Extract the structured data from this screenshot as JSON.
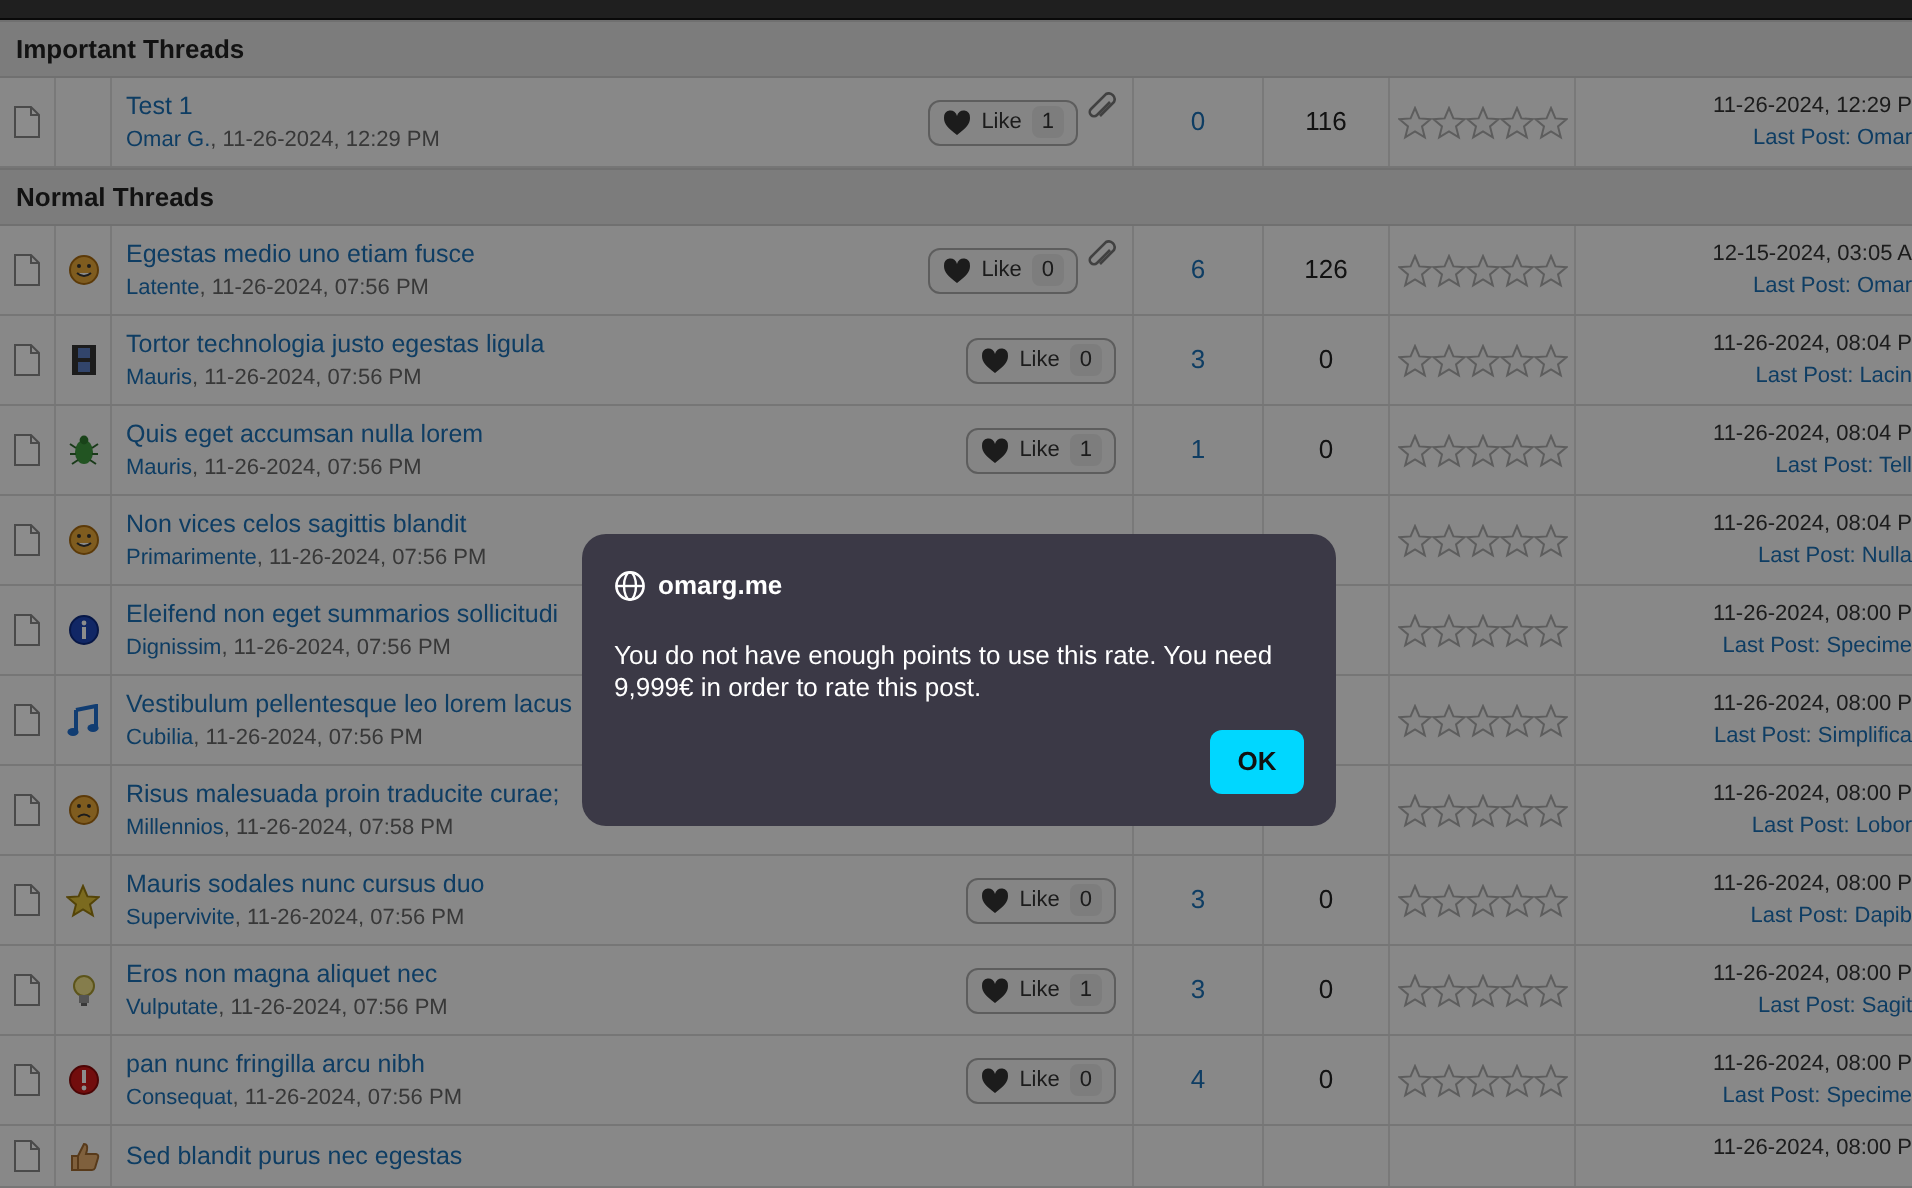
{
  "sections": [
    {
      "title": "Important Threads",
      "rows": [
        {
          "title": "Test 1",
          "author": "Omar G.",
          "date": ", 11-26-2024, 12:29 PM",
          "kind": "none",
          "like": {
            "label": "Like",
            "count": "1"
          },
          "attachment": true,
          "replies": "0",
          "views": "116",
          "stars": 0,
          "last_date": "11-26-2024, 12:29 P",
          "last_post": "Last Post: Omar"
        }
      ]
    },
    {
      "title": "Normal Threads",
      "rows": [
        {
          "title": "Egestas medio uno etiam fusce",
          "author": "Latente",
          "date": ", 11-26-2024, 07:56 PM",
          "kind": "smile",
          "like": {
            "label": "Like",
            "count": "0"
          },
          "attachment": true,
          "replies": "6",
          "views": "126",
          "stars": 0,
          "last_date": "12-15-2024, 03:05 A",
          "last_post": "Last Post: Omar"
        },
        {
          "title": "Tortor technologia justo egestas ligula",
          "author": "Mauris",
          "date": ", 11-26-2024, 07:56 PM",
          "kind": "film",
          "like": {
            "label": "Like",
            "count": "0"
          },
          "attachment": false,
          "replies": "3",
          "views": "0",
          "stars": 0,
          "last_date": "11-26-2024, 08:04 P",
          "last_post": "Last Post: Lacin"
        },
        {
          "title": "Quis eget accumsan nulla lorem",
          "author": "Mauris",
          "date": ", 11-26-2024, 07:56 PM",
          "kind": "bug",
          "like": {
            "label": "Like",
            "count": "1"
          },
          "attachment": false,
          "replies": "1",
          "views": "0",
          "stars": 0,
          "last_date": "11-26-2024, 08:04 P",
          "last_post": "Last Post: Tell"
        },
        {
          "title": "Non vices celos sagittis blandit",
          "author": "Primarimente",
          "date": ", 11-26-2024, 07:56 PM",
          "kind": "smile",
          "attachment": false,
          "stars": 0,
          "last_date": "11-26-2024, 08:04 P",
          "last_post": "Last Post: Nulla"
        },
        {
          "title": "Eleifend non eget summarios sollicitudi",
          "author": "Dignissim",
          "date": ", 11-26-2024, 07:56 PM",
          "kind": "info",
          "attachment": false,
          "stars": 0,
          "last_date": "11-26-2024, 08:00 P",
          "last_post": "Last Post: Specime"
        },
        {
          "title": "Vestibulum pellentesque leo lorem lacus",
          "author": "Cubilia",
          "date": ", 11-26-2024, 07:56 PM",
          "kind": "music",
          "attachment": false,
          "stars": 0,
          "last_date": "11-26-2024, 08:00 P",
          "last_post": "Last Post: Simplifica"
        },
        {
          "title": "Risus malesuada proin traducite curae;",
          "author": "Millennios",
          "date": ", 11-26-2024, 07:58 PM",
          "kind": "sad",
          "attachment": false,
          "stars": 0,
          "last_date": "11-26-2024, 08:00 P",
          "last_post": "Last Post: Lobor"
        },
        {
          "title": "Mauris sodales nunc cursus duo",
          "author": "Supervivite",
          "date": ", 11-26-2024, 07:56 PM",
          "kind": "star",
          "like": {
            "label": "Like",
            "count": "0"
          },
          "attachment": false,
          "replies": "3",
          "views": "0",
          "stars": 0,
          "last_date": "11-26-2024, 08:00 P",
          "last_post": "Last Post: Dapib"
        },
        {
          "title": "Eros non magna aliquet nec",
          "author": "Vulputate",
          "date": ", 11-26-2024, 07:56 PM",
          "kind": "bulb",
          "like": {
            "label": "Like",
            "count": "1"
          },
          "attachment": false,
          "replies": "3",
          "views": "0",
          "stars": 0,
          "last_date": "11-26-2024, 08:00 P",
          "last_post": "Last Post: Sagit"
        },
        {
          "title": "pan nunc fringilla arcu nibh",
          "author": "Consequat",
          "date": ", 11-26-2024, 07:56 PM",
          "kind": "alert",
          "like": {
            "label": "Like",
            "count": "0"
          },
          "attachment": false,
          "replies": "4",
          "views": "0",
          "stars": 0,
          "last_date": "11-26-2024, 08:00 P",
          "last_post": "Last Post: Specime"
        },
        {
          "title": "Sed blandit purus nec egestas",
          "kind": "thumb",
          "attachment": false,
          "last_date": "11-26-2024, 08:00 P"
        }
      ]
    }
  ],
  "dialog": {
    "site": "omarg.me",
    "message": "You do not have enough points to use this rate. You need 9,999€ in order to rate this post.",
    "button": "OK"
  }
}
